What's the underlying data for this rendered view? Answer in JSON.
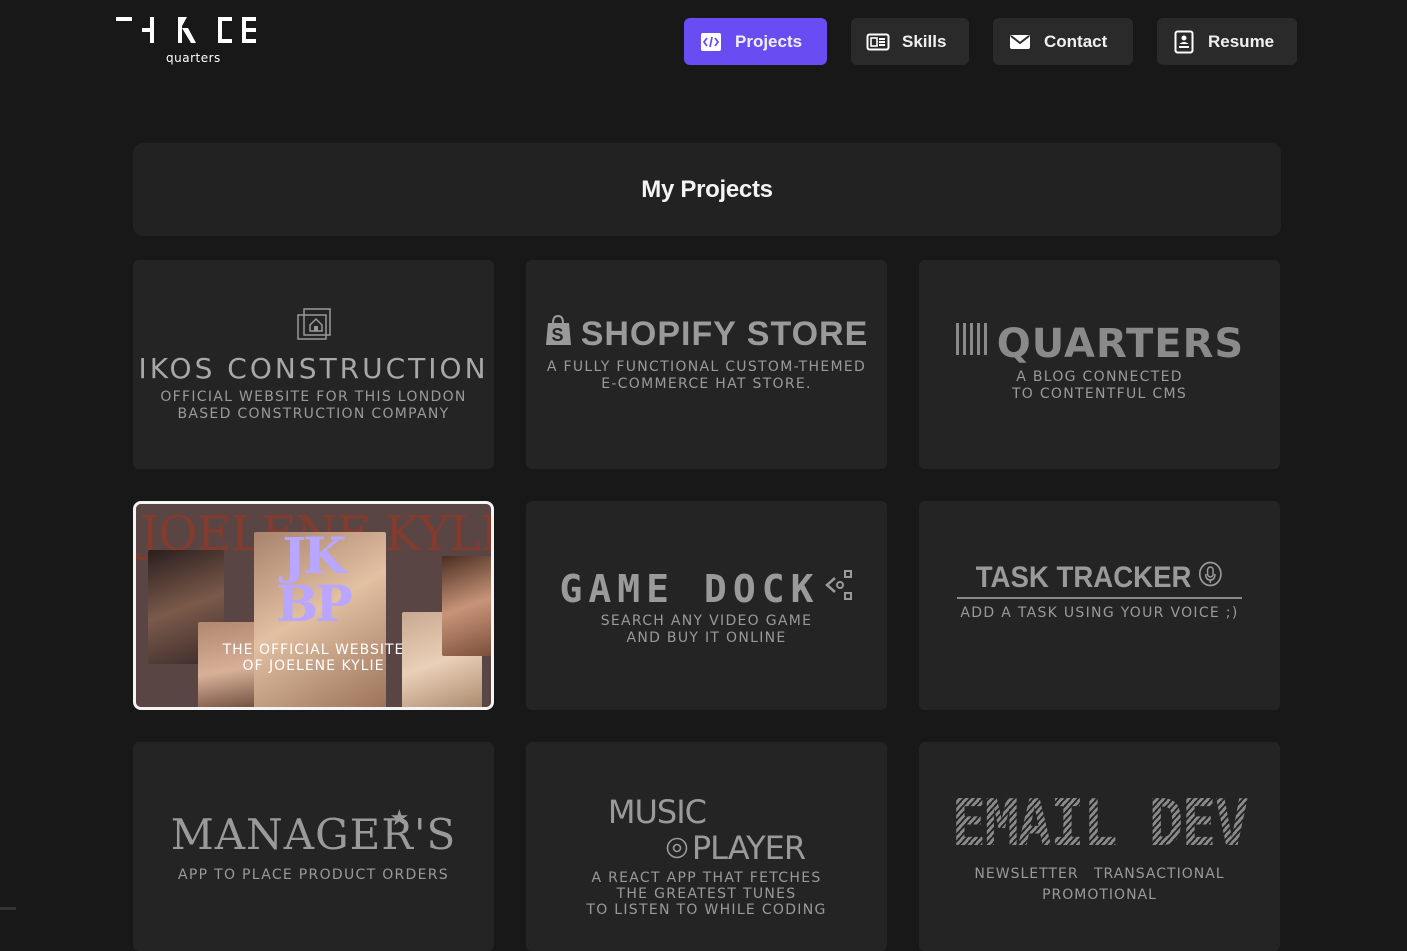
{
  "header": {
    "logo_main": "THREE",
    "logo_sub": "quarters",
    "nav": [
      {
        "label": "Projects",
        "icon": "code-icon",
        "active": true
      },
      {
        "label": "Skills",
        "icon": "newspaper-icon",
        "active": false
      },
      {
        "label": "Contact",
        "icon": "mail-icon",
        "active": false
      },
      {
        "label": "Resume",
        "icon": "resume-icon",
        "active": false
      }
    ]
  },
  "main": {
    "heading": "My Projects",
    "projects": [
      {
        "title": "IKOS CONSTRUCTION",
        "line1": "OFFICIAL WEBSITE FOR THIS LONDON",
        "line2": "BASED CONSTRUCTION COMPANY"
      },
      {
        "title": "SHOPIFY STORE",
        "line1": "A FULLY FUNCTIONAL CUSTOM-THEMED",
        "line2": "E-COMMERCE HAT STORE."
      },
      {
        "title": "QUARTERS",
        "line1": "A BLOG CONNECTED",
        "line2": "TO CONTENTFUL CMS"
      },
      {
        "title_band": "JOELENE KYLIE",
        "logo_line1": "JK",
        "logo_line2": "BP",
        "line1": "THE OFFICIAL WEBSITE",
        "line2": "OF JOELENE KYLIE",
        "selected": true
      },
      {
        "title": "GAME DOCK",
        "line1": "SEARCH ANY VIDEO GAME",
        "line2": "AND BUY IT ONLINE"
      },
      {
        "title": "TASK TRACKER",
        "line1": "ADD A TASK USING YOUR VOICE ;)"
      },
      {
        "title": "MANAGER'S",
        "line1": "APP TO PLACE PRODUCT ORDERS"
      },
      {
        "title_line1": "MUSIC",
        "title_line2": "PLAYER",
        "line1": "A REACT APP THAT FETCHES",
        "line2": "THE GREATEST TUNES",
        "line3": "TO LISTEN TO WHILE CODING"
      },
      {
        "title": "EMAIL DEV",
        "tag1": "NEWSLETTER",
        "tag2": "TRANSACTIONAL",
        "tag3": "PROMOTIONAL"
      }
    ]
  },
  "colors": {
    "background": "#181818",
    "card": "#242424",
    "accent": "#6a4cf3",
    "jk_logo": "#b8a6ff"
  }
}
